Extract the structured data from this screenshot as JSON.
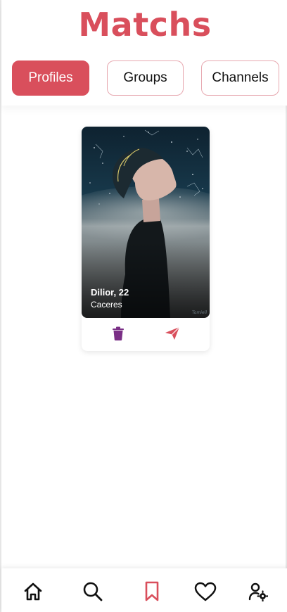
{
  "header": {
    "title": "Matchs"
  },
  "tabs": [
    {
      "label": "Profiles",
      "active": true
    },
    {
      "label": "Groups",
      "active": false
    },
    {
      "label": "Channels",
      "active": false
    }
  ],
  "profile_card": {
    "name_age": "Dilior, 22",
    "city": "Caceres",
    "artist_signature": "Tomiell",
    "actions": [
      "trash-icon",
      "send-icon"
    ]
  },
  "bottom_nav": {
    "items": [
      "home-icon",
      "search-icon",
      "bookmark-icon",
      "heart-icon",
      "user-settings-icon"
    ],
    "active": "bookmark-icon"
  },
  "colors": {
    "accent": "#d94f5c",
    "tab_border": "#e7a8b0",
    "trash": "#7a2f86",
    "send": "#d94f5c"
  }
}
